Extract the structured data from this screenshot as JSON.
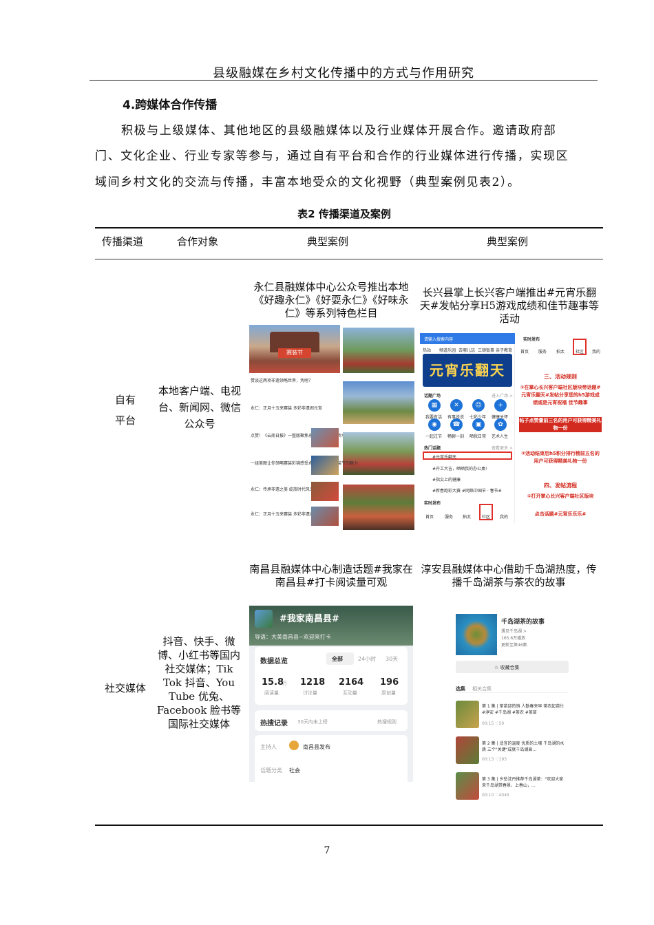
{
  "running_header": "县级融媒在乡村文化传播中的方式与作用研究",
  "section_heading": "4.跨媒体合作传播",
  "body_lines": [
    "积极与上级媒体、其他地区的县级融媒体以及行业媒体开展合作。邀请政府部",
    "门、文化企业、行业专家等参与，通过自有平台和合作的行业媒体进行传播，实现区",
    "域间乡村文化的交流与传播，丰富本地受众的文化视野（典型案例见表2）。"
  ],
  "table": {
    "caption": "表2  传播渠道及案例",
    "headers": [
      "传播渠道",
      "合作对象",
      "典型案例",
      "典型案例"
    ],
    "rows": [
      {
        "channel": "自有平台",
        "partners": "本地客户端、电视台、新闻网、微信公众号",
        "case_a": "永仁县融媒体中心公众号推出本地《好趣永仁》《好耍永仁》《好味永仁》等系列特色栏目",
        "case_b": "长兴县掌上长兴客户端推出#元宵乐翻天#发帖分享H5游戏成绩和佳节趣事等活动"
      },
      {
        "channel": "社交媒体",
        "partners": "抖音、快手、微博、小红书等国内社交媒体；Tik Tok 抖音、You Tube 优兔、Facebook 脸书等国际社交媒体",
        "case_a": "南昌县融媒体中心制造话题#我家在南昌县#打卡阅读量可观",
        "case_b": "淳安县融媒体中心借助千岛湖热度，传播千岛湖茶与茶农的故事"
      }
    ]
  },
  "screenshots": {
    "yongren": {
      "captions": [
        "赞谈这两项非遗领略世界，凭啥？",
        "永仁：正月十五来赛装 多彩非遗闹元宵",
        "点赞！《云南日报》一整版聚焦永仁直苴赛装节传承非遗展风情",
        "一组美图让你领略赛装彩锦感受永仁直苴赛装赛装节的魅力",
        "永仁：传承非遗之美 绽放时代风采",
        "永仁：正月十五来赛装 多彩非遗闹元宵"
      ],
      "banner": "赛装节"
    },
    "changxing": {
      "search": "请输入搜索内容",
      "tabs": [
        "热站",
        "频道乐园",
        "去哪儿玩",
        "三顿饭事",
        "亲子教育"
      ],
      "banner_title": "元宵乐翻天",
      "section_square": "话题广场",
      "section_square_more": "进入广场 >",
      "icons": [
        "我要有话",
        "有事说说",
        "七彩少年",
        "健康关怀",
        "一起过节",
        "畅聊一刻",
        "晒我日常",
        "艺术人生"
      ],
      "hot_topics": "热门话题",
      "hot_more": "查看更多 >",
      "topics": [
        "#元宵乐翻天",
        "#开工大吉，晒晒我的办公桌!",
        "#指尖上的健康",
        "#新春跑彩大赛 #网络中国节 · 春节#"
      ],
      "nav_title": "实时发布",
      "nav": [
        "首页",
        "服务",
        "拍太",
        "社区",
        "我的"
      ],
      "rules": [
        "三、活动规则",
        "①在掌心长兴客户端社区版块带话题#元宵乐翻天#发帖分享您的h5游戏成绩或是元宵祝福 佳节趣事",
        "帖子点赞量前三名的用户可获得精美礼物一份",
        "②活动结束后h5积分排行榜前五名的用户可获得精美礼物一份",
        "四、发帖流程",
        "①打开掌心长兴客户端社区版块",
        "点击话题#元宵乐乐乐#"
      ]
    },
    "nanchang": {
      "topic": "#我家南昌县#",
      "intro": "导语：大美南昌县~欢迎来打卡",
      "overview": "数据总览",
      "filters": [
        "全部",
        "24小时",
        "30天"
      ],
      "stats": [
        {
          "value": "15.8",
          "unit": "万",
          "label": "阅读量"
        },
        {
          "value": "1218",
          "unit": "",
          "label": "讨论量"
        },
        {
          "value": "2164",
          "unit": "",
          "label": "互动量"
        },
        {
          "value": "196",
          "unit": "",
          "label": "原创量"
        }
      ],
      "hot_record": "热搜记录",
      "hot_record_note": "30天内未上榜",
      "hot_rule": "热搜规则",
      "host_label": "主持人",
      "host_name": "南昌县发布",
      "category_label": "话题分类",
      "category_value": "社会"
    },
    "chunan": {
      "title": "千岛湖茶的故事",
      "subtitle": "遇见千岛湖 >",
      "plays": "165.6万播放",
      "updated": "更新至第46集",
      "collect": "☆ 收藏合集",
      "tabs": [
        "选集",
        "相关合集"
      ],
      "episodes": [
        {
          "title": "第 1 集 | 茶苗迎热销 人勤春来早 茶农起苗忙#淳安 #千岛湖 #茶农 #茶苗",
          "meta": "00:15   ♡50"
        },
        {
          "title": "第 2 集 | 适宜的温度 优质的土壤 千岛湖的水质 三个\"关键\"成就千岛湖高...",
          "meta": "00:13   ♡193"
        },
        {
          "title": "第 3 集 | 乡愁沈丹推荐千岛湖茶：\"欢迎大家来千岛湖赏春景、上春山，...",
          "meta": "00:10   ♡4045"
        }
      ]
    }
  },
  "page_number": "7"
}
